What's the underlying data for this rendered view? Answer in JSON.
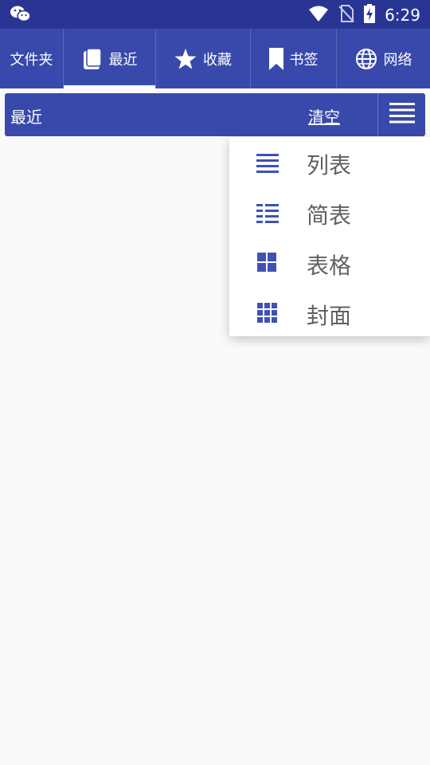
{
  "status_bar": {
    "time": "6:29"
  },
  "tabs": [
    {
      "label": "文件夹",
      "icon": "folder-icon"
    },
    {
      "label": "最近",
      "icon": "book-icon"
    },
    {
      "label": "收藏",
      "icon": "star-icon"
    },
    {
      "label": "书签",
      "icon": "bookmark-icon"
    },
    {
      "label": "网络",
      "icon": "globe-icon"
    }
  ],
  "header": {
    "title": "最近",
    "clear_label": "清空"
  },
  "view_menu": {
    "items": [
      {
        "label": "列表",
        "icon": "list-icon"
      },
      {
        "label": "简表",
        "icon": "compact-list-icon"
      },
      {
        "label": "表格",
        "icon": "grid-icon"
      },
      {
        "label": "封面",
        "icon": "cover-grid-icon"
      }
    ]
  },
  "colors": {
    "primary": "#3949ab",
    "primary_dark": "#283593",
    "icon_accent": "#3f51b5"
  }
}
